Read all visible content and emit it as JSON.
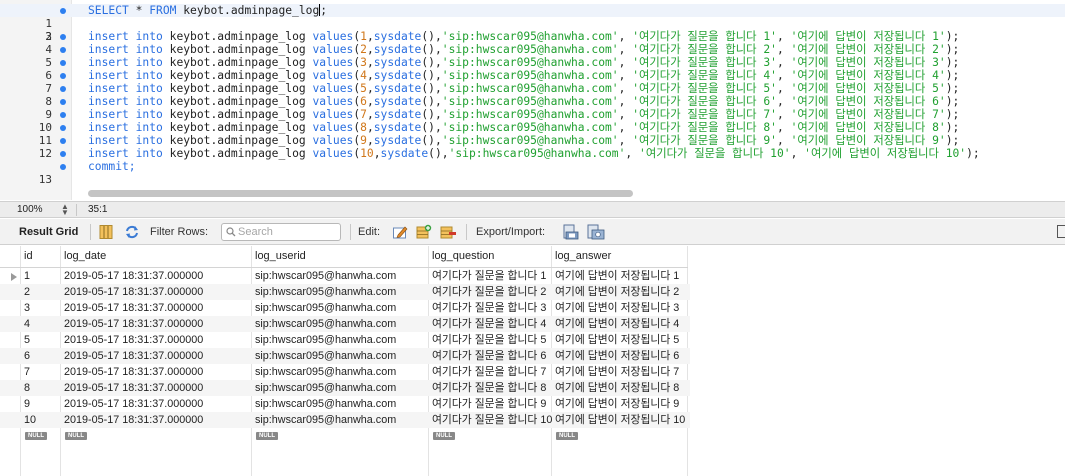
{
  "editor": {
    "line_numbers": [
      "1",
      "2",
      "3",
      "4",
      "5",
      "6",
      "7",
      "8",
      "9",
      "10",
      "11",
      "12",
      "13"
    ],
    "select_line": {
      "kw_select": "SELECT",
      "star": " * ",
      "kw_from": "FROM",
      "table": " keybot.adminpage_log",
      "semi": ";"
    },
    "insert_template": {
      "kw_insert": "insert",
      "kw_into": "into",
      "table": "keybot.adminpage_log",
      "kw_values": "values",
      "fn_sysdate": "sysdate",
      "userid": "'sip:hwscar095@hanwha.com'"
    },
    "insert_rows": [
      {
        "n": "1",
        "q": "'여기다가 질문을 합니다 1'",
        "a": "'여기에 답변이 저장됩니다 1'"
      },
      {
        "n": "2",
        "q": "'여기다가 질문을 합니다 2'",
        "a": "'여기에 답변이 저장됩니다 2'"
      },
      {
        "n": "3",
        "q": "'여기다가 질문을 합니다 3'",
        "a": "'여기에 답변이 저장됩니다 3'"
      },
      {
        "n": "4",
        "q": "'여기다가 질문을 합니다 4'",
        "a": "'여기에 답변이 저장됩니다 4'"
      },
      {
        "n": "5",
        "q": "'여기다가 질문을 합니다 5'",
        "a": "'여기에 답변이 저장됩니다 5'"
      },
      {
        "n": "6",
        "q": "'여기다가 질문을 합니다 6'",
        "a": "'여기에 답변이 저장됩니다 6'"
      },
      {
        "n": "7",
        "q": "'여기다가 질문을 합니다 7'",
        "a": "'여기에 답변이 저장됩니다 7'"
      },
      {
        "n": "8",
        "q": "'여기다가 질문을 합니다 8'",
        "a": "'여기에 답변이 저장됩니다 8'"
      },
      {
        "n": "9",
        "q": "'여기다가 질문을 합니다 9'",
        "a": "'여기에 답변이 저장됩니다 9'"
      },
      {
        "n": "10",
        "q": "'여기다가 질문을 합니다 10'",
        "a": "'여기에 답변이 저장됩니다 10'"
      }
    ],
    "commit_line": "commit;"
  },
  "status": {
    "zoom": "100%",
    "cursor_position": "35:1"
  },
  "toolbar": {
    "result_grid_label": "Result Grid",
    "filter_rows_label": "Filter Rows:",
    "search_placeholder": "Search",
    "edit_label": "Edit:",
    "export_import_label": "Export/Import:"
  },
  "grid": {
    "columns": [
      "id",
      "log_date",
      "log_userid",
      "log_question",
      "log_answer"
    ],
    "rows": [
      [
        "1",
        "2019-05-17 18:31:37.000000",
        "sip:hwscar095@hanwha.com",
        "여기다가 질문을 합니다 1",
        "여기에 답변이 저장됩니다 1"
      ],
      [
        "2",
        "2019-05-17 18:31:37.000000",
        "sip:hwscar095@hanwha.com",
        "여기다가 질문을 합니다 2",
        "여기에 답변이 저장됩니다 2"
      ],
      [
        "3",
        "2019-05-17 18:31:37.000000",
        "sip:hwscar095@hanwha.com",
        "여기다가 질문을 합니다 3",
        "여기에 답변이 저장됩니다 3"
      ],
      [
        "4",
        "2019-05-17 18:31:37.000000",
        "sip:hwscar095@hanwha.com",
        "여기다가 질문을 합니다 4",
        "여기에 답변이 저장됩니다 4"
      ],
      [
        "5",
        "2019-05-17 18:31:37.000000",
        "sip:hwscar095@hanwha.com",
        "여기다가 질문을 합니다 5",
        "여기에 답변이 저장됩니다 5"
      ],
      [
        "6",
        "2019-05-17 18:31:37.000000",
        "sip:hwscar095@hanwha.com",
        "여기다가 질문을 합니다 6",
        "여기에 답변이 저장됩니다 6"
      ],
      [
        "7",
        "2019-05-17 18:31:37.000000",
        "sip:hwscar095@hanwha.com",
        "여기다가 질문을 합니다 7",
        "여기에 답변이 저장됩니다 7"
      ],
      [
        "8",
        "2019-05-17 18:31:37.000000",
        "sip:hwscar095@hanwha.com",
        "여기다가 질문을 합니다 8",
        "여기에 답변이 저장됩니다 8"
      ],
      [
        "9",
        "2019-05-17 18:31:37.000000",
        "sip:hwscar095@hanwha.com",
        "여기다가 질문을 합니다 9",
        "여기에 답변이 저장됩니다 9"
      ],
      [
        "10",
        "2019-05-17 18:31:37.000000",
        "sip:hwscar095@hanwha.com",
        "여기다가 질문을 합니다 10",
        "여기에 답변이 저장됩니다 10"
      ]
    ],
    "null_label": "NULL"
  },
  "colors": {
    "keyword": "#2a6fe0",
    "number": "#d0771a",
    "string": "#20a030",
    "breakpoint_dot": "#2d7ff0"
  }
}
